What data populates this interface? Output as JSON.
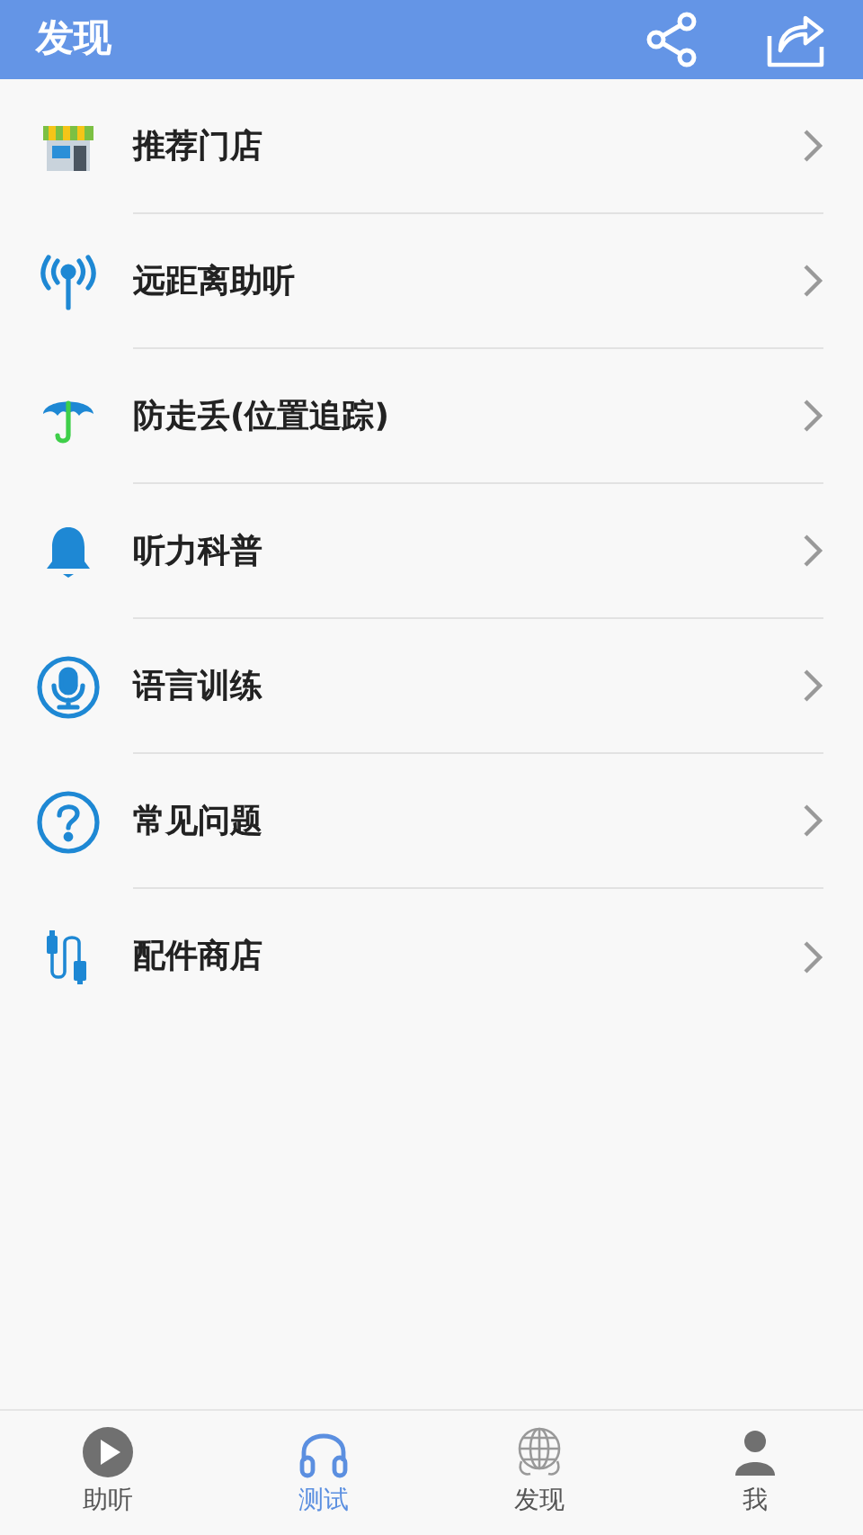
{
  "header": {
    "title": "发现"
  },
  "menu": [
    {
      "label": "推荐门店"
    },
    {
      "label": "远距离助听"
    },
    {
      "label": "防走丢(位置追踪)"
    },
    {
      "label": "听力科普"
    },
    {
      "label": "语言训练"
    },
    {
      "label": "常见问题"
    },
    {
      "label": "配件商店"
    }
  ],
  "tab_bar": [
    {
      "label": "助听",
      "selected": false
    },
    {
      "label": "测试",
      "selected": true
    },
    {
      "label": "发现",
      "selected": false
    },
    {
      "label": "我",
      "selected": false
    }
  ]
}
